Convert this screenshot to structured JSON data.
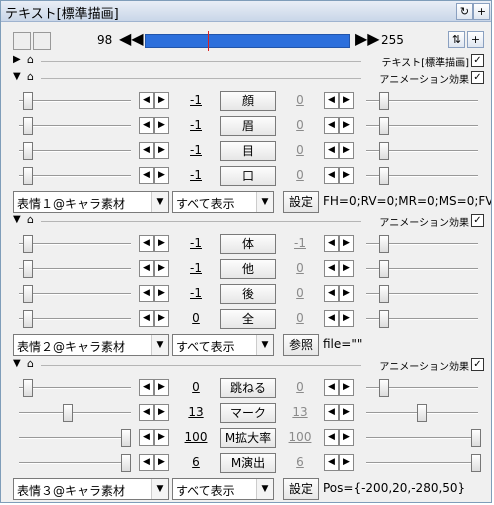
{
  "window": {
    "title": "テキスト[標準描画]"
  },
  "toolbar": {
    "start_frame": "98",
    "end_frame": "255",
    "rewind_icon": "double-left-arrow",
    "forward_icon": "double-right-arrow"
  },
  "text_layer": {
    "label": "テキスト[標準描画]",
    "checked": true
  },
  "groups": [
    {
      "header": "アニメーション効果",
      "rows": [
        {
          "value": "-1",
          "label": "顔",
          "right": "0"
        },
        {
          "value": "-1",
          "label": "眉",
          "right": "0"
        },
        {
          "value": "-1",
          "label": "目",
          "right": "0"
        },
        {
          "value": "-1",
          "label": "口",
          "right": "0"
        }
      ],
      "select1": "表情１@キャラ素材",
      "select2": "すべて表示",
      "button": "設定",
      "info": "FH=0;RV=0;MR=0;MS=0;FV"
    },
    {
      "header": "アニメーション効果",
      "rows": [
        {
          "value": "-1",
          "label": "体",
          "right": "-1"
        },
        {
          "value": "-1",
          "label": "他",
          "right": "0"
        },
        {
          "value": "-1",
          "label": "後",
          "right": "0"
        },
        {
          "value": "0",
          "label": "全",
          "right": "0"
        }
      ],
      "select1": "表情２@キャラ素材",
      "select2": "すべて表示",
      "button": "参照",
      "info": "file=\"\""
    },
    {
      "header": "アニメーション効果",
      "rows": [
        {
          "value": "0",
          "label": "跳ねる",
          "right": "0"
        },
        {
          "value": "13",
          "label": "マーク",
          "right": "13"
        },
        {
          "value": "100",
          "label": "M拡大率",
          "right": "100"
        },
        {
          "value": "6",
          "label": "M演出",
          "right": "6"
        }
      ],
      "select1": "表情３@キャラ素材",
      "select2": "すべて表示",
      "button": "設定",
      "info": "Pos={-200,20,-280,50}"
    }
  ]
}
